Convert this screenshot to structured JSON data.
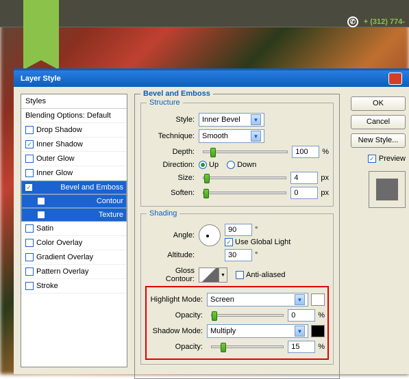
{
  "header": {
    "phone": "+ (312) 774-"
  },
  "dialog": {
    "title": "Layer Style"
  },
  "styles": {
    "header": "Styles",
    "blending": "Blending Options: Default",
    "items": [
      {
        "label": "Drop Shadow",
        "checked": false,
        "sel": false,
        "sub": false
      },
      {
        "label": "Inner Shadow",
        "checked": true,
        "sel": false,
        "sub": false
      },
      {
        "label": "Outer Glow",
        "checked": false,
        "sel": false,
        "sub": false
      },
      {
        "label": "Inner Glow",
        "checked": false,
        "sel": false,
        "sub": false
      },
      {
        "label": "Bevel and Emboss",
        "checked": true,
        "sel": true,
        "sub": false
      },
      {
        "label": "Contour",
        "checked": false,
        "sel": true,
        "sub": true
      },
      {
        "label": "Texture",
        "checked": false,
        "sel": true,
        "sub": true
      },
      {
        "label": "Satin",
        "checked": false,
        "sel": false,
        "sub": false
      },
      {
        "label": "Color Overlay",
        "checked": false,
        "sel": false,
        "sub": false
      },
      {
        "label": "Gradient Overlay",
        "checked": false,
        "sel": false,
        "sub": false
      },
      {
        "label": "Pattern Overlay",
        "checked": false,
        "sel": false,
        "sub": false
      },
      {
        "label": "Stroke",
        "checked": false,
        "sel": false,
        "sub": false
      }
    ]
  },
  "bevel": {
    "title": "Bevel and Emboss",
    "structure": {
      "title": "Structure",
      "style_lbl": "Style:",
      "style_val": "Inner Bevel",
      "tech_lbl": "Technique:",
      "tech_val": "Smooth",
      "depth_lbl": "Depth:",
      "depth_val": "100",
      "depth_unit": "%",
      "dir_lbl": "Direction:",
      "up": "Up",
      "down": "Down",
      "size_lbl": "Size:",
      "size_val": "4",
      "size_unit": "px",
      "soften_lbl": "Soften:",
      "soften_val": "0",
      "soften_unit": "px"
    },
    "shading": {
      "title": "Shading",
      "angle_lbl": "Angle:",
      "angle_val": "90",
      "angle_unit": "°",
      "global": "Use Global Light",
      "alt_lbl": "Altitude:",
      "alt_val": "30",
      "alt_unit": "°",
      "gloss_lbl": "Gloss Contour:",
      "anti": "Anti-aliased",
      "hmode_lbl": "Highlight Mode:",
      "hmode_val": "Screen",
      "hopac_lbl": "Opacity:",
      "hopac_val": "0",
      "hopac_unit": "%",
      "smode_lbl": "Shadow Mode:",
      "smode_val": "Multiply",
      "sopac_lbl": "Opacity:",
      "sopac_val": "15",
      "sopac_unit": "%"
    }
  },
  "right": {
    "ok": "OK",
    "cancel": "Cancel",
    "new_style": "New Style...",
    "preview": "Preview"
  }
}
